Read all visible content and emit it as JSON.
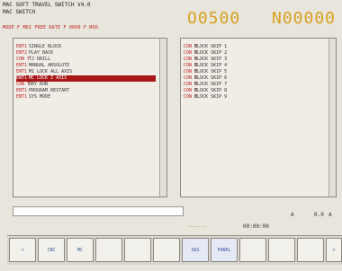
{
  "header": {
    "line1": "MAC SOFT TRAVEL SWITCH V4.0",
    "line2": "MAC SWITCH",
    "mode_line": "MODE F MDI FREE  RATE F 0000 F MOD",
    "program_number": "O0500",
    "sequence_number": "N00000"
  },
  "left_list": {
    "items": [
      {
        "state": "ENT1",
        "name": "SINGLE BLOCK"
      },
      {
        "state": "ENT2",
        "name": "PLAY BACK"
      },
      {
        "state": "CON T",
        "name": "TJ DRILL"
      },
      {
        "state": "ENT1",
        "name": "MANUAL ABSOLUTE"
      },
      {
        "state": "ENT1",
        "name": "M1 LOCK ALL AXIS"
      },
      {
        "state": "ENT1",
        "name": "MC LOCK Z AXIS"
      },
      {
        "state": "CON T",
        "name": "DRY RUN"
      },
      {
        "state": "ENT1",
        "name": "PROGRAM RESTART"
      },
      {
        "state": "ENT1",
        "name": "SYS MODE"
      }
    ],
    "selected_index": 5
  },
  "right_list": {
    "items": [
      {
        "state": "CON T",
        "name": "BLOCK SKIP 1"
      },
      {
        "state": "CON T",
        "name": "BLOCK SKIP 2"
      },
      {
        "state": "CON T",
        "name": "BLOCK SKIP 3"
      },
      {
        "state": "CON T",
        "name": "BLOCK SKIP 4"
      },
      {
        "state": "CON T",
        "name": "BLOCK SKIP 5"
      },
      {
        "state": "CON T",
        "name": "BLOCK SKIP 6"
      },
      {
        "state": "CON T",
        "name": "BLOCK SKIP 7"
      },
      {
        "state": "CON T",
        "name": "BLOCK SKIP 8"
      },
      {
        "state": "CON T",
        "name": "BLOCK SKIP 9"
      }
    ]
  },
  "status": {
    "a": "A",
    "b": "0.0",
    "c": "A",
    "d": "------",
    "e": "00:00:00"
  },
  "softkeys": [
    "<",
    "CNC",
    "MC",
    "",
    "",
    "",
    "SW1",
    "PANEL",
    "",
    "",
    "",
    "",
    ">"
  ]
}
